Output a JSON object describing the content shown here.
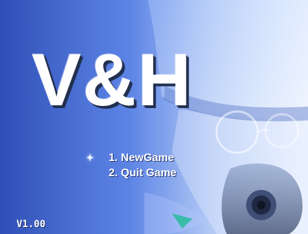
{
  "game": {
    "title": "V&H",
    "menu_items": [
      {
        "label": "1. NewGame",
        "selected": true
      },
      {
        "label": "2. Quit Game",
        "selected": false
      }
    ],
    "version": "V1.00"
  },
  "colors": {
    "background_left": "#2f4fb6",
    "background_right": "#d7e6ff",
    "title_text": "#ffffff",
    "menu_text": "#ffffff"
  },
  "icons": {
    "selection_cursor": "sparkle-icon"
  }
}
